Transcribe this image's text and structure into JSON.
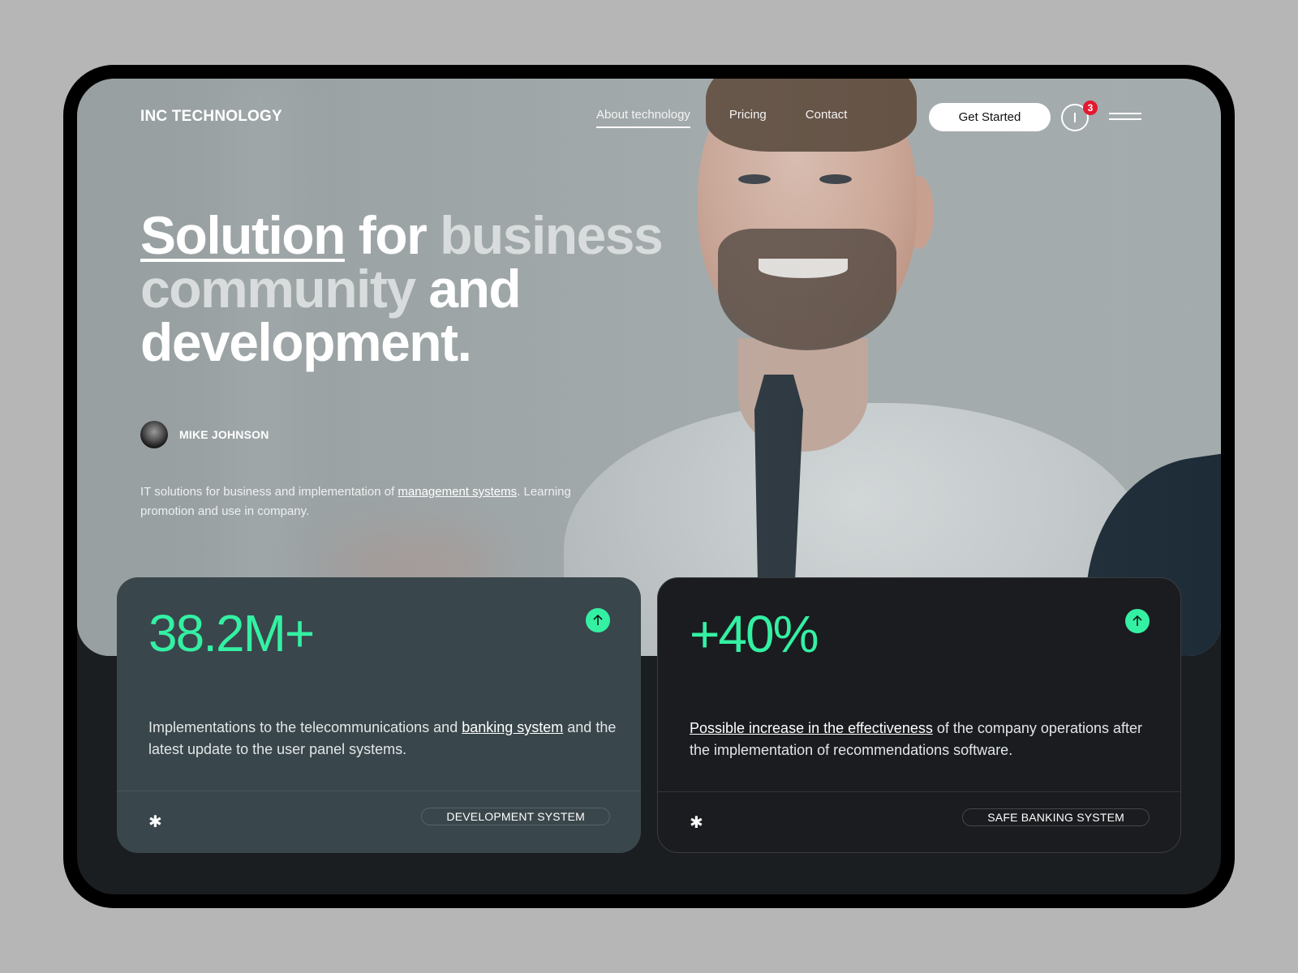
{
  "header": {
    "logo": "INC TECHNOLOGY",
    "nav": [
      {
        "label": "About technology",
        "active": true
      },
      {
        "label": "Pricing",
        "active": false
      },
      {
        "label": "Contact",
        "active": false
      }
    ],
    "cta_label": "Get Started",
    "power_icon": "power-icon",
    "notification_count": "3",
    "menu_icon": "hamburger-menu-icon"
  },
  "hero": {
    "headline": {
      "w1": "Solution",
      "w2": "for",
      "w3": "business",
      "w4": "community",
      "w5": "and",
      "w6": "development."
    },
    "author": "MIKE JOHNSON",
    "intro": {
      "before": "IT solutions for business and implementation of ",
      "link": "management systems",
      "after": ". Learning promotion and use in company."
    }
  },
  "cards": [
    {
      "stat": "38.2M+",
      "desc_before": "Implementations to the telecommunications and ",
      "desc_link": "banking system",
      "desc_after": " and the latest update to the user panel systems.",
      "tag": "DEVELOPMENT SYSTEM",
      "marker": "✱"
    },
    {
      "stat": "+40%",
      "desc_link": "Possible increase in the effectiveness",
      "desc_after": " of the company operations after the implementation of recommendations software.",
      "tag": "SAFE BANKING SYSTEM",
      "marker": "✱"
    }
  ],
  "colors": {
    "accent": "#34f0a3",
    "badge": "#e3192f",
    "card_left": "#39464b",
    "card_right": "#1a1c1f"
  }
}
